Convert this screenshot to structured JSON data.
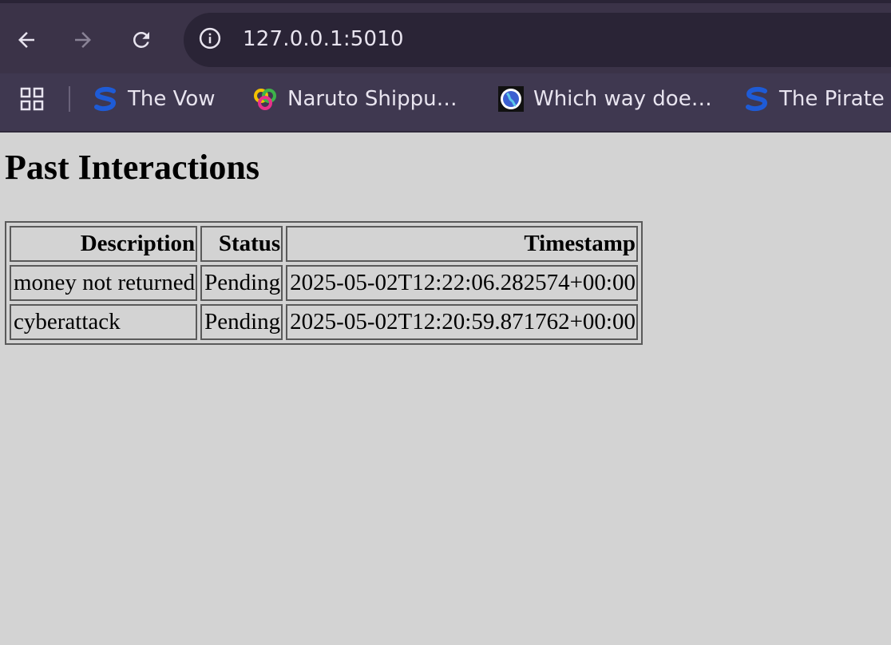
{
  "browser": {
    "url": "127.0.0.1:5010",
    "bookmarks": [
      {
        "label": "The Vow",
        "icon": "s-logo-icon"
      },
      {
        "label": "Naruto Shippu…",
        "icon": "rings-icon"
      },
      {
        "label": "Which way doe…",
        "icon": "globe-icon"
      },
      {
        "label": "The Pirate",
        "icon": "s-logo-icon"
      }
    ],
    "colors": {
      "toolbar": "#3b3348",
      "omnibox": "#2a2436",
      "text": "#e8e4ef"
    }
  },
  "page": {
    "title": "Past Interactions",
    "table": {
      "headers": [
        "Description",
        "Status",
        "Timestamp"
      ],
      "rows": [
        [
          "money not returned",
          "Pending",
          "2025-05-02T12:22:06.282574+00:00"
        ],
        [
          "cyberattack",
          "Pending",
          "2025-05-02T12:20:59.871762+00:00"
        ]
      ]
    },
    "colors": {
      "background": "#d3d3d3"
    }
  }
}
